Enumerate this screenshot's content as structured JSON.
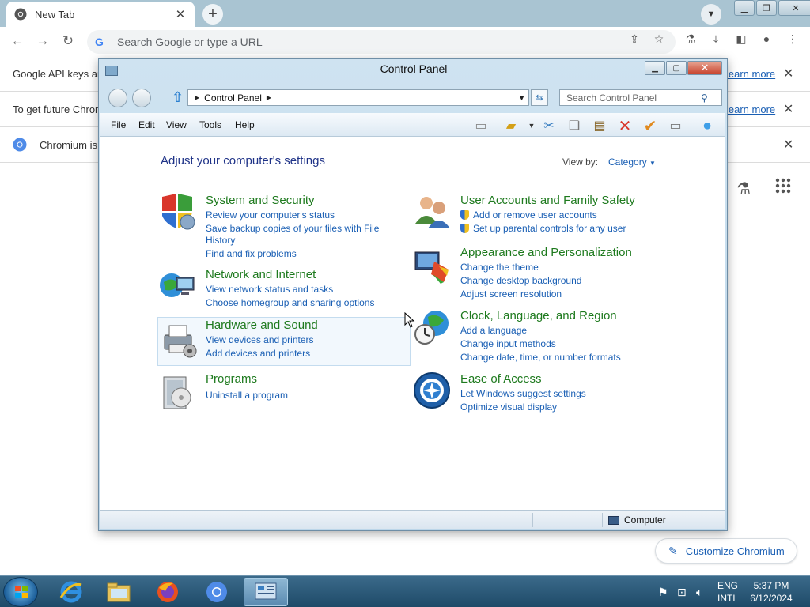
{
  "browser": {
    "tab_title": "New Tab",
    "omnibox_placeholder": "Search Google or type a URL",
    "infobars": [
      {
        "text": "Google API keys are",
        "learn": "learn more"
      },
      {
        "text": "To get future Chrom",
        "learn": "learn more"
      },
      {
        "text": "Chromium is",
        "learn": ""
      }
    ],
    "customize_label": "Customize Chromium"
  },
  "control_panel": {
    "title": "Control Panel",
    "address": "Control Panel",
    "search_placeholder": "Search Control Panel",
    "menu": [
      "File",
      "Edit",
      "View",
      "Tools",
      "Help"
    ],
    "heading": "Adjust your computer's settings",
    "view_by_label": "View by:",
    "view_by_value": "Category",
    "status_location": "Computer",
    "categories": [
      {
        "title": "System and Security",
        "links": [
          "Review your computer's status",
          "Save backup copies of your files with File",
          "History",
          "Find and fix problems"
        ]
      },
      {
        "title": "Network and Internet",
        "links": [
          "View network status and tasks",
          "Choose homegroup and sharing options"
        ]
      },
      {
        "title": "Hardware and Sound",
        "links": [
          "View devices and printers",
          "Add devices and printers"
        ]
      },
      {
        "title": "Programs",
        "links": [
          "Uninstall a program"
        ]
      },
      {
        "title": "User Accounts and Family Safety",
        "links": [
          "Add or remove user accounts",
          "Set up parental controls for any user"
        ]
      },
      {
        "title": "Appearance and Personalization",
        "links": [
          "Change the theme",
          "Change desktop background",
          "Adjust screen resolution"
        ]
      },
      {
        "title": "Clock, Language, and Region",
        "links": [
          "Add a language",
          "Change input methods",
          "Change date, time, or number formats"
        ]
      },
      {
        "title": "Ease of Access",
        "links": [
          "Let Windows suggest settings",
          "Optimize visual display"
        ]
      }
    ]
  },
  "taskbar": {
    "lang_top": "ENG",
    "lang_bottom": "INTL",
    "time": "5:37 PM",
    "date": "6/12/2024"
  }
}
